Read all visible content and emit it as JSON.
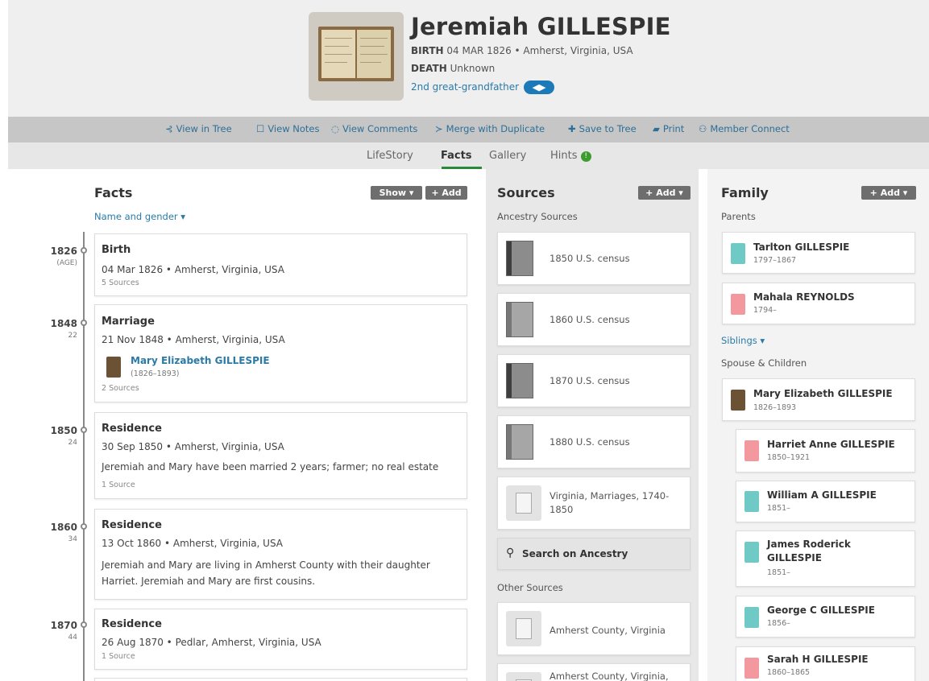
{
  "person": {
    "name": "Jeremiah GILLESPIE",
    "birth_label": "BIRTH",
    "birth_value": "04 MAR 1826 • Amherst, Virginia, USA",
    "death_label": "DEATH",
    "death_value": "Unknown",
    "relationship": "2nd great-grandfather"
  },
  "toolbar": {
    "view_in_tree": "View in Tree",
    "view_notes": "View Notes",
    "view_comments": "View Comments",
    "merge": "Merge with Duplicate",
    "save": "Save to Tree",
    "print": "Print",
    "member_connect": "Member Connect"
  },
  "tabs": {
    "lifestory": "LifeStory",
    "facts": "Facts",
    "gallery": "Gallery",
    "hints": "Hints",
    "hints_count": "!"
  },
  "facts": {
    "title": "Facts",
    "show_btn": "Show ▾",
    "add_btn": "+ Add",
    "name_gender": "Name and gender ▾",
    "events": [
      {
        "year": "1826",
        "age": "(AGE)",
        "title": "Birth",
        "date": "04 Mar 1826 • Amherst, Virginia, USA",
        "sources": "5 Sources"
      },
      {
        "year": "1848",
        "age": "22",
        "title": "Marriage",
        "date": "21 Nov 1848 • Amherst, Virginia, USA",
        "spouse_name": "Mary Elizabeth GILLESPIE",
        "spouse_dates": "(1826–1893)",
        "sources": "2 Sources"
      },
      {
        "year": "1850",
        "age": "24",
        "title": "Residence",
        "date": "30 Sep 1850 • Amherst, Virginia, USA",
        "desc": "Jeremiah and Mary have been married 2 years; farmer; no real estate",
        "sources": "1 Source"
      },
      {
        "year": "1860",
        "age": "34",
        "title": "Residence",
        "date": "13 Oct 1860 • Amherst, Virginia, USA",
        "desc": "Jeremiah and Mary are living in Amherst County with their daughter Harriet. Jeremiah and Mary are first cousins."
      },
      {
        "year": "1870",
        "age": "44",
        "title": "Residence",
        "date": "26 Aug 1870 • Pedlar, Amherst, Virginia, USA",
        "sources": "1 Source"
      }
    ]
  },
  "sources": {
    "title": "Sources",
    "add_btn": "+ Add ▾",
    "ancestry_label": "Ancestry Sources",
    "items": [
      {
        "label": "1850 U.S. census"
      },
      {
        "label": "1860 U.S. census"
      },
      {
        "label": "1870 U.S. census"
      },
      {
        "label": "1880 U.S. census"
      },
      {
        "label_line1": "Virginia, Marriages, 1740-",
        "label_line2": "1850"
      }
    ],
    "search": "Search on Ancestry",
    "other_label": "Other Sources",
    "other_items": [
      {
        "label": "Amherst County, Virginia"
      },
      {
        "label": "Amherst County, Virginia,"
      }
    ]
  },
  "family": {
    "title": "Family",
    "add_btn": "+ Add ▾",
    "parents_label": "Parents",
    "parents": [
      {
        "name": "Tarlton GILLESPIE",
        "dates": "1797–1867"
      },
      {
        "name": "Mahala REYNOLDS",
        "dates": "1794–"
      }
    ],
    "siblings_label": "Siblings ▾",
    "spouse_children_label": "Spouse & Children",
    "spouse": {
      "name": "Mary Elizabeth GILLESPIE",
      "dates": "1826–1893"
    },
    "children": [
      {
        "name": "Harriet Anne GILLESPIE",
        "dates": "1850–1921"
      },
      {
        "name": "William A GILLESPIE",
        "dates": "1851–"
      },
      {
        "name_line1": "James Roderick",
        "name_line2": "GILLESPIE",
        "dates": "1851–"
      },
      {
        "name": "George C GILLESPIE",
        "dates": "1856–"
      },
      {
        "name": "Sarah H GILLESPIE",
        "dates": "1860–1865"
      }
    ]
  },
  "colors": {
    "link": "#2a7aa8",
    "active_tab_underline": "#2a8a3a",
    "male_avatar": "#6fc9c4",
    "female_avatar": "#f3989e"
  }
}
